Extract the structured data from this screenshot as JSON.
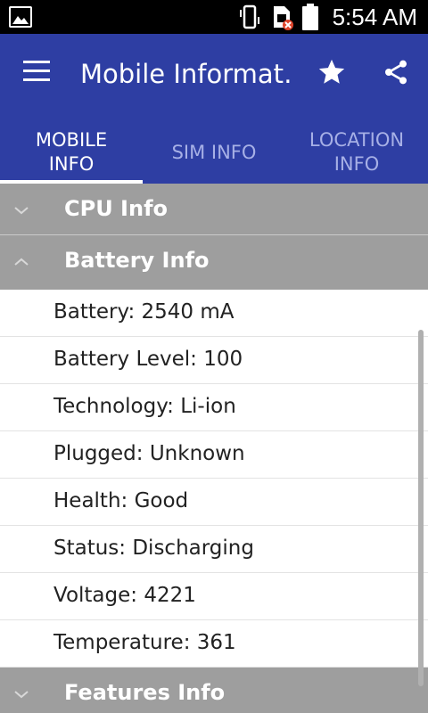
{
  "status_bar": {
    "time": "5:54 AM",
    "icons": [
      "gallery-notification-icon",
      "vibrate-icon",
      "sim-error-icon",
      "battery-icon"
    ]
  },
  "app_bar": {
    "title": "Mobile Informat…",
    "icons": [
      "menu-icon",
      "star-icon",
      "share-icon"
    ],
    "color": "#2e3ea3"
  },
  "tabs": [
    {
      "label": "MOBILE\nINFO",
      "active": true
    },
    {
      "label": "SIM INFO",
      "active": false
    },
    {
      "label": "LOCATION\nINFO",
      "active": false
    }
  ],
  "groups": {
    "cpu": {
      "label": "CPU Info",
      "expanded": false
    },
    "battery": {
      "label": "Battery Info",
      "expanded": true
    },
    "features": {
      "label": "Features Info",
      "expanded": false
    }
  },
  "battery_rows": [
    "Battery: 2540 mA",
    "Battery Level: 100",
    "Technology: Li-ion",
    "Plugged: Unknown",
    "Health: Good",
    "Status: Discharging",
    "Voltage: 4221",
    "Temperature: 361"
  ]
}
